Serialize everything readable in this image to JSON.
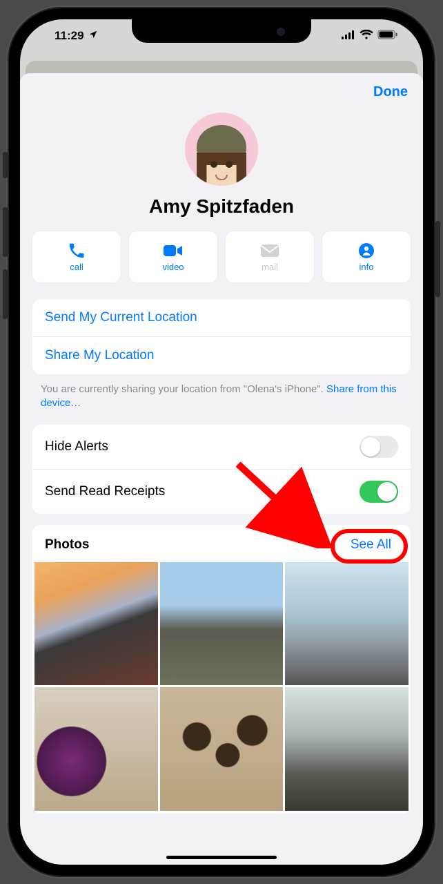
{
  "status": {
    "time": "11:29",
    "location_services": true
  },
  "nav": {
    "done": "Done"
  },
  "contact": {
    "name": "Amy Spitzfaden",
    "avatar_kind": "memoji"
  },
  "actions": {
    "call": {
      "label": "call",
      "enabled": true
    },
    "video": {
      "label": "video",
      "enabled": true
    },
    "mail": {
      "label": "mail",
      "enabled": false
    },
    "info": {
      "label": "info",
      "enabled": true
    }
  },
  "location_card": {
    "send_current": "Send My Current Location",
    "share": "Share My Location"
  },
  "footnote": {
    "prefix": "You are currently sharing your location from \"Olena's iPhone\". ",
    "link": "Share from this device…"
  },
  "settings": {
    "hide_alerts": {
      "label": "Hide Alerts",
      "on": false
    },
    "read_receipts": {
      "label": "Send Read Receipts",
      "on": true
    }
  },
  "photos": {
    "title": "Photos",
    "see_all": "See All",
    "count_visible": 6
  },
  "annotation": {
    "target": "see-all-button",
    "shape": "oval",
    "color": "#ff0000"
  },
  "colors": {
    "accent": "#007aff",
    "toggle_on": "#34c759",
    "sheet_bg": "#f2f2f6"
  }
}
